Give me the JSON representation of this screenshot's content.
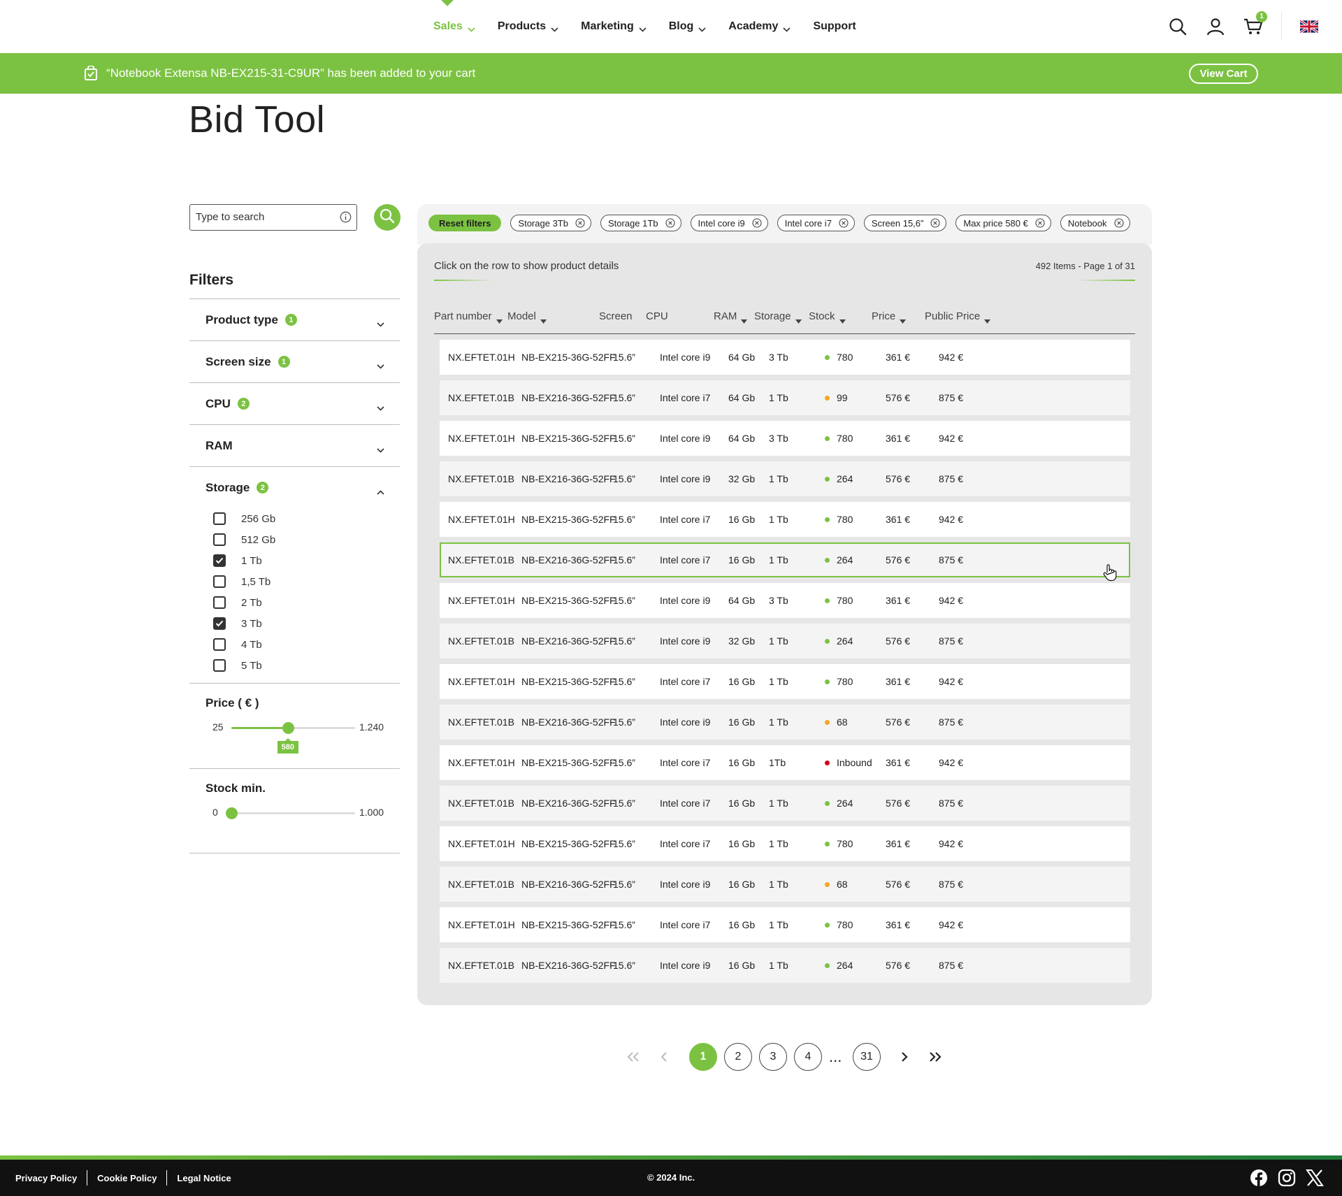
{
  "nav": {
    "items": [
      {
        "label": "Sales",
        "active": true,
        "has_menu": true
      },
      {
        "label": "Products",
        "active": false,
        "has_menu": true
      },
      {
        "label": "Marketing",
        "active": false,
        "has_menu": true
      },
      {
        "label": "Blog",
        "active": false,
        "has_menu": true
      },
      {
        "label": "Academy",
        "active": false,
        "has_menu": true
      },
      {
        "label": "Support",
        "active": false,
        "has_menu": false
      }
    ],
    "cart_count": "1",
    "icons": [
      "search-icon",
      "user-icon",
      "cart-icon",
      "uk-flag-icon"
    ]
  },
  "banner": {
    "message": "“Notebook Extensa NB-EX215-31-C9UR” has been added to your cart",
    "button": "View Cart"
  },
  "page": {
    "title": "Bid Tool"
  },
  "search": {
    "placeholder": "Type to search"
  },
  "filters": {
    "title": "Filters",
    "sections": [
      {
        "label": "Product type",
        "badge": "1"
      },
      {
        "label": "Screen size",
        "badge": "1"
      },
      {
        "label": "CPU",
        "badge": "2"
      },
      {
        "label": "RAM",
        "badge": ""
      }
    ],
    "storage": {
      "label": "Storage",
      "badge": "2",
      "options": [
        {
          "label": "256 Gb",
          "checked": false
        },
        {
          "label": "512 Gb",
          "checked": false
        },
        {
          "label": "1 Tb",
          "checked": true
        },
        {
          "label": "1,5 Tb",
          "checked": false
        },
        {
          "label": "2 Tb",
          "checked": false
        },
        {
          "label": "3 Tb",
          "checked": true
        },
        {
          "label": "4 Tb",
          "checked": false
        },
        {
          "label": "5 Tb",
          "checked": false
        }
      ]
    },
    "price": {
      "label": "Price ( € )",
      "min_label": "25",
      "max_label": "1.240",
      "min": 25,
      "max": 1240,
      "value": 580,
      "value_label": "580"
    },
    "stock": {
      "label": "Stock min.",
      "min_label": "0",
      "max_label": "1.000",
      "min": 0,
      "max": 1000,
      "value": 0
    }
  },
  "chips": {
    "reset": "Reset filters",
    "items": [
      "Storage 3Tb",
      "Storage 1Tb",
      "Intel core i9",
      "Intel core i7",
      "Screen 15,6”",
      "Max price 580 €",
      "Notebook"
    ]
  },
  "table": {
    "hint": "Click on the row to show product details",
    "count": "492 Items  -  Page 1 of 31",
    "columns": [
      "Part number",
      "Model",
      "Screen",
      "CPU",
      "RAM",
      "Storage",
      "Stock",
      "Price",
      "Public Price"
    ],
    "sortable": [
      true,
      true,
      false,
      false,
      true,
      true,
      true,
      true,
      true
    ],
    "selected_row": 5,
    "rows": [
      {
        "part": "NX.EFTET.01H",
        "model": "NB-EX215-36G-52FF",
        "screen": "15.6”",
        "cpu": "Intel core i9",
        "ram": "64 Gb",
        "storage": "3 Tb",
        "stock": "780",
        "stock_status": "green",
        "price": "361 €",
        "public": "942 €"
      },
      {
        "part": "NX.EFTET.01B",
        "model": "NB-EX216-36G-52FF",
        "screen": "15.6”",
        "cpu": "Intel core i7",
        "ram": "64 Gb",
        "storage": "1 Tb",
        "stock": "99",
        "stock_status": "orange",
        "price": "576 €",
        "public": "875 €"
      },
      {
        "part": "NX.EFTET.01H",
        "model": "NB-EX215-36G-52FF",
        "screen": "15.6”",
        "cpu": "Intel core i9",
        "ram": "64 Gb",
        "storage": "3 Tb",
        "stock": "780",
        "stock_status": "green",
        "price": "361 €",
        "public": "942 €"
      },
      {
        "part": "NX.EFTET.01B",
        "model": "NB-EX216-36G-52FF",
        "screen": "15.6”",
        "cpu": "Intel core i9",
        "ram": "32 Gb",
        "storage": "1 Tb",
        "stock": "264",
        "stock_status": "green",
        "price": "576 €",
        "public": "875 €"
      },
      {
        "part": "NX.EFTET.01H",
        "model": "NB-EX215-36G-52FF",
        "screen": "15.6”",
        "cpu": "Intel core i7",
        "ram": "16 Gb",
        "storage": "1 Tb",
        "stock": "780",
        "stock_status": "green",
        "price": "361 €",
        "public": "942 €"
      },
      {
        "part": "NX.EFTET.01B",
        "model": "NB-EX216-36G-52FF",
        "screen": "15.6”",
        "cpu": "Intel core i7",
        "ram": "16 Gb",
        "storage": "1 Tb",
        "stock": "264",
        "stock_status": "green",
        "price": "576 €",
        "public": "875 €"
      },
      {
        "part": "NX.EFTET.01H",
        "model": "NB-EX215-36G-52FF",
        "screen": "15.6”",
        "cpu": "Intel core i9",
        "ram": "64 Gb",
        "storage": "3 Tb",
        "stock": "780",
        "stock_status": "green",
        "price": "361 €",
        "public": "942 €"
      },
      {
        "part": "NX.EFTET.01B",
        "model": "NB-EX216-36G-52FF",
        "screen": "15.6”",
        "cpu": "Intel core i9",
        "ram": "32 Gb",
        "storage": "1 Tb",
        "stock": "264",
        "stock_status": "green",
        "price": "576 €",
        "public": "875 €"
      },
      {
        "part": "NX.EFTET.01H",
        "model": "NB-EX215-36G-52FF",
        "screen": "15.6”",
        "cpu": "Intel core i7",
        "ram": "16 Gb",
        "storage": "1 Tb",
        "stock": "780",
        "stock_status": "green",
        "price": "361 €",
        "public": "942 €"
      },
      {
        "part": "NX.EFTET.01B",
        "model": "NB-EX216-36G-52FF",
        "screen": "15.6”",
        "cpu": "Intel core i9",
        "ram": "16 Gb",
        "storage": "1 Tb",
        "stock": "68",
        "stock_status": "orange",
        "price": "576 €",
        "public": "875 €"
      },
      {
        "part": "NX.EFTET.01H",
        "model": "NB-EX215-36G-52FF",
        "screen": "15.6”",
        "cpu": "Intel core i7",
        "ram": "16 Gb",
        "storage": "1Tb",
        "stock": "Inbound",
        "stock_status": "red",
        "price": "361 €",
        "public": "942 €"
      },
      {
        "part": "NX.EFTET.01B",
        "model": "NB-EX216-36G-52FF",
        "screen": "15.6”",
        "cpu": "Intel core i7",
        "ram": "16 Gb",
        "storage": "1 Tb",
        "stock": "264",
        "stock_status": "green",
        "price": "576 €",
        "public": "875 €"
      },
      {
        "part": "NX.EFTET.01H",
        "model": "NB-EX215-36G-52FF",
        "screen": "15.6”",
        "cpu": "Intel core i7",
        "ram": "16 Gb",
        "storage": "1 Tb",
        "stock": "780",
        "stock_status": "green",
        "price": "361 €",
        "public": "942 €"
      },
      {
        "part": "NX.EFTET.01B",
        "model": "NB-EX216-36G-52FF",
        "screen": "15.6”",
        "cpu": "Intel core i9",
        "ram": "16 Gb",
        "storage": "1 Tb",
        "stock": "68",
        "stock_status": "orange",
        "price": "576 €",
        "public": "875 €"
      },
      {
        "part": "NX.EFTET.01H",
        "model": "NB-EX215-36G-52FF",
        "screen": "15.6”",
        "cpu": "Intel core i7",
        "ram": "16 Gb",
        "storage": "1 Tb",
        "stock": "780",
        "stock_status": "green",
        "price": "361 €",
        "public": "942 €"
      },
      {
        "part": "NX.EFTET.01B",
        "model": "NB-EX216-36G-52FF",
        "screen": "15.6”",
        "cpu": "Intel core i9",
        "ram": "16 Gb",
        "storage": "1 Tb",
        "stock": "264",
        "stock_status": "green",
        "price": "576 €",
        "public": "875 €"
      }
    ]
  },
  "pagination": {
    "pages": [
      "1",
      "2",
      "3",
      "4"
    ],
    "ellipsis": "...",
    "last": "31",
    "current": "1"
  },
  "footer": {
    "links": [
      "Privacy Policy",
      "Cookie Policy",
      "Legal Notice"
    ],
    "copyright": "© 2024  Inc.",
    "socials": [
      "facebook-icon",
      "instagram-icon",
      "x-icon"
    ]
  },
  "colors": {
    "accent": "#7cc242",
    "stock_green": "#7cc242",
    "stock_orange": "#f5a623",
    "stock_red": "#d0021b",
    "footer_bg": "#111111"
  }
}
